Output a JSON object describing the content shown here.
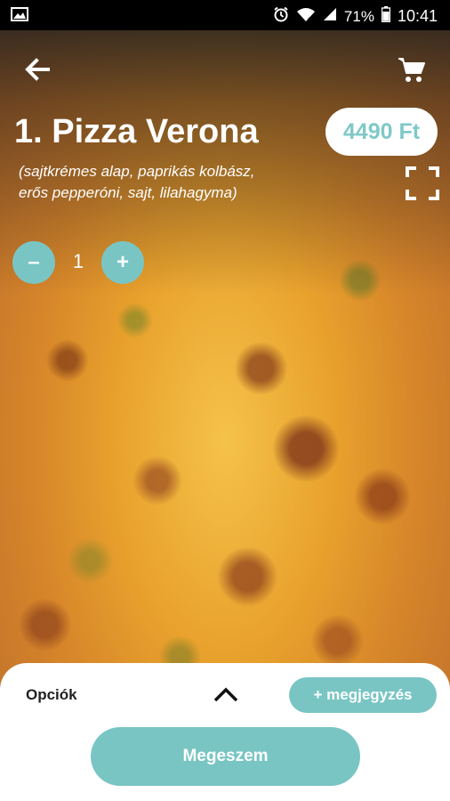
{
  "status_bar": {
    "battery_percent": "71%",
    "time": "10:41",
    "icons": [
      "image-icon",
      "alarm-icon",
      "wifi-icon",
      "signal-icon",
      "battery-icon"
    ]
  },
  "header": {
    "back_icon": "arrow-left-icon",
    "cart_icon": "cart-icon",
    "fullscreen_icon": "fullscreen-icon"
  },
  "product": {
    "title": "1. Pizza Verona",
    "price": "4490 Ft",
    "description": "(sajtkrémes alap, paprikás kolbász, erős pepperóni, sajt, lilahagyma)",
    "quantity": "1",
    "minus_label": "–",
    "plus_label": "+"
  },
  "panel": {
    "options_label": "Opciók",
    "note_button": "+ megjegyzés",
    "submit_button": "Megeszem"
  },
  "colors": {
    "accent": "#79c5c4",
    "price_text": "#7fc9c8",
    "white": "#ffffff"
  }
}
